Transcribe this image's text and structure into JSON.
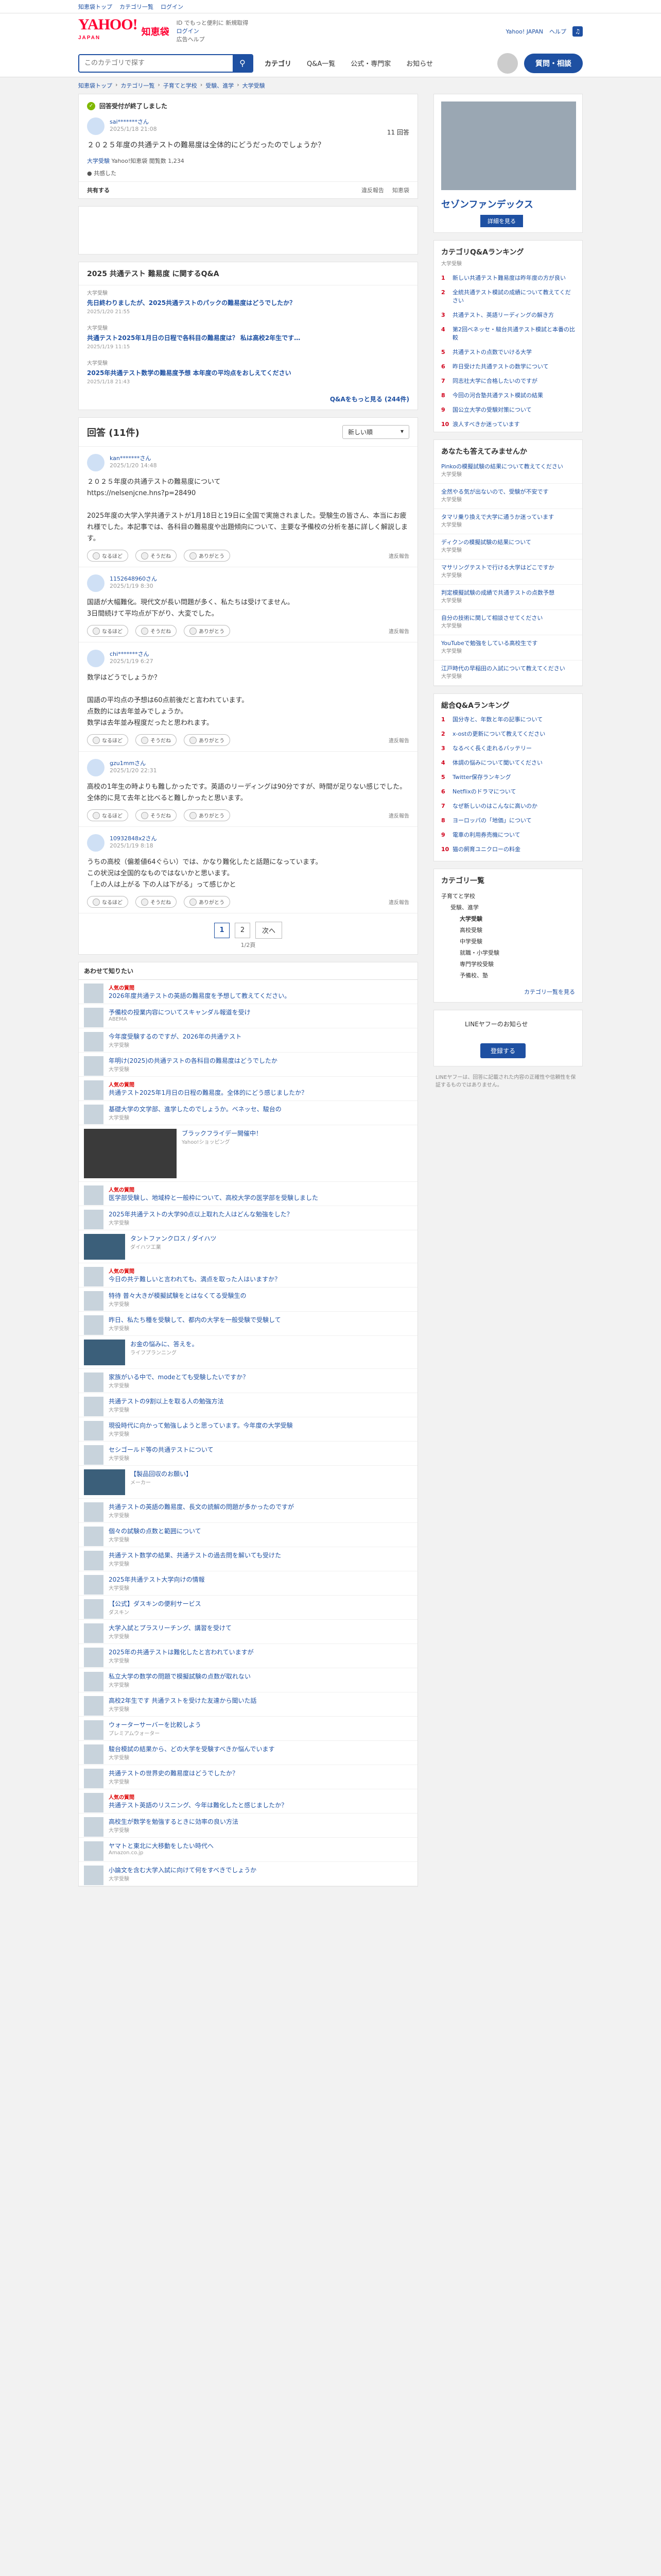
{
  "topbar": {
    "links": [
      "知恵袋トップ",
      "カテゴリ一覧",
      "ログイン"
    ]
  },
  "header": {
    "logo": "YAHOO!",
    "logo_sub": "JAPAN",
    "service": "知恵袋",
    "lines": [
      "ID でもっと便利に 新規取得",
      "ログイン",
      "広告ヘルプ"
    ],
    "right_links": [
      "Yahoo! JAPAN",
      "ヘルプ"
    ]
  },
  "nav": {
    "search_placeholder": "このカテゴリで探す",
    "items": [
      "カテゴリ",
      "Q&A一覧",
      "公式・専門家",
      "お知らせ"
    ],
    "ask_label": "質問・相談"
  },
  "breadcrumb": [
    "知恵袋トップ",
    "カテゴリ一覧",
    "子育てと学校",
    "受験、進学",
    "大学受験"
  ],
  "question": {
    "solved_label": "回答受付が終了しました",
    "user": "sai*******さん",
    "date": "2025/1/18 21:08",
    "text": "２０２５年度の共通テストの難易度は全体的にどうだったのでしょうか？",
    "tag_label": "大学受験",
    "tag2": "Yahoo!知恵袋",
    "views": "閲覧数 1,234",
    "answers": "11 回答",
    "thanks": "共感した",
    "share": "共有する",
    "foot": [
      "違反報告",
      "知恵袋"
    ]
  },
  "related": {
    "title": "2025 共通テスト 難易度 に関するQ&A",
    "items": [
      {
        "cat": "大学受験",
        "title": "先日終わりましたが、2025共通テストのパックの難易度はどうでしたか？",
        "meta": "2025/1/20 21:55"
      },
      {
        "cat": "大学受験",
        "title": "共通テスト2025年1月日の日程で各科目の難易度は？ 私は高校2年生です…",
        "meta": "2025/1/19 11:15"
      },
      {
        "cat": "大学受験",
        "title": "2025年共通テスト数学の難易度予想 本年度の平均点をおしえてください",
        "meta": "2025/1/18 21:43"
      }
    ],
    "more": "Q&Aをもっと見る (244件)"
  },
  "answers": {
    "title": "回答 (11件)",
    "sort": "新しい順",
    "react_labels": [
      "なるほど",
      "そうだね",
      "ありがとう"
    ],
    "report": "違反報告",
    "items": [
      {
        "user": "kan*******さん",
        "date": "2025/1/20 14:48",
        "text": "２０２５年度の共通テストの難易度について\nhttps://nelsenjcne.hns?p=28490\n\n2025年度の大学入学共通テストが1月18日と19日に全国で実施されました。受験生の皆さん、本当にお疲れ様でした。本記事では、各科目の難易度や出題傾向について、主要な予備校の分析を基に詳しく解説します。"
      },
      {
        "user": "1152648960さん",
        "date": "2025/1/19 8:30",
        "text": "国語が大幅難化。現代文が長い問題が多く、私たちは受けてません。\n3日間続けて平均点が下がり、大変でした。"
      },
      {
        "user": "chi*******さん",
        "date": "2025/1/19 6:27",
        "text": "数学はどうでしょうか？\n\n国語の平均点の予想は60点前後だと言われています。\n点数的には去年並みでしょうか。\n数学は去年並み程度だったと思われます。"
      },
      {
        "user": "gzu1mmさん",
        "date": "2025/1/20 22:31",
        "text": "高校の1年生の時よりも難しかったです。英語のリーディングは90分ですが、時間が足りない感じでした。\n全体的に見て去年と比べると難しかったと思います。"
      },
      {
        "user": "10932848x2さん",
        "date": "2025/1/19 8:18",
        "text": "うちの高校（偏差値64ぐらい）では、かなり難化したと話題になっています。\nこの状況は全国的なものではないかと思います。\n「上の人は上がる 下の人は下がる」って感じかと"
      }
    ],
    "pages": [
      "1",
      "2"
    ],
    "next": "次へ",
    "count": "1/2頁"
  },
  "feed": {
    "title": "あわせて知りたい",
    "items": [
      {
        "hot": "人気の質問",
        "title": "2026年度共通テストの英語の難易度を予想して教えてください。",
        "cat": "大学受験"
      },
      {
        "hot": "",
        "title": "予備校の授業内容についてスキャンダル報道を受け",
        "cat": "ABEMA"
      },
      {
        "hot": "",
        "title": "今年度受験するのですが、2026年の共通テスト",
        "cat": "大学受験"
      },
      {
        "hot": "",
        "title": "年明け(2025)の共通テストの各科目の難易度はどうでしたか",
        "cat": "大学受験"
      },
      {
        "hot": "人気の質問",
        "title": "共通テスト2025年1月日の日程の難易度。全体的にどう感じましたか？",
        "cat": "大学受験"
      },
      {
        "hot": "",
        "title": "基礎大学の文学部、進学したのでしょうか。ベネッセ、駿台の",
        "cat": "大学受験"
      },
      {
        "hot": "",
        "title": "ブラックフライデー開催中！",
        "cat": "Yahoo!ショッピング"
      },
      {
        "hot": "人気の質問",
        "title": "医学部受験し、地域枠と一般枠について、高校大学の医学部を受験しました",
        "cat": "大学受験"
      },
      {
        "hot": "",
        "title": "2025年共通テストの大学90点以上取れた人はどんな勉強をした？",
        "cat": "大学受験"
      },
      {
        "hot": "",
        "title": "タントファンクロス / ダイハツ",
        "cat": "ダイハツ工業"
      },
      {
        "hot": "人気の質問",
        "title": "今日の共テ難しいと言われても、満点を取った人はいますか？",
        "cat": "大学受験"
      },
      {
        "hot": "",
        "title": "特待 普々大きが模擬試験をとはなくてる受験生の",
        "cat": "大学受験"
      },
      {
        "hot": "",
        "title": "昨日、私たち種を受験して、都内の大学を一般受験で受験して",
        "cat": "大学受験"
      },
      {
        "hot": "",
        "title": "お金の悩みに、答えを。",
        "cat": "ライフプランニング"
      },
      {
        "hot": "",
        "title": "家族がいる中で、modeとても受験したいですか？",
        "cat": "大学受験"
      },
      {
        "hot": "",
        "title": "共通テストの9割以上を取る人の勉強方法",
        "cat": "大学受験"
      },
      {
        "hot": "",
        "title": "現役時代に向かって勉強しようと思っています。今年度の大学受験",
        "cat": "大学受験"
      },
      {
        "hot": "",
        "title": "セシゴールド等の共通テストについて",
        "cat": "大学受験"
      },
      {
        "hot": "",
        "title": "【製品回収のお願い】",
        "cat": "メーカー"
      },
      {
        "hot": "",
        "title": "共通テストの英語の難易度、長文の読解の問題が多かったのですが",
        "cat": "大学受験"
      },
      {
        "hot": "",
        "title": "個々の試験の点数と範囲について",
        "cat": "大学受験"
      },
      {
        "hot": "",
        "title": "共通テスト数学の結果、共通テストの過去問を解いても受けた",
        "cat": "大学受験"
      },
      {
        "hot": "",
        "title": "2025年共通テスト大学向けの情報",
        "cat": "大学受験"
      },
      {
        "hot": "",
        "title": "【公式】ダスキンの便利サービス",
        "cat": "ダスキン"
      },
      {
        "hot": "",
        "title": "大学入試とプラスリーチング、講習を受けて",
        "cat": "大学受験"
      },
      {
        "hot": "",
        "title": "2025年の共通テストは難化したと言われていますが",
        "cat": "大学受験"
      },
      {
        "hot": "",
        "title": "私立大学の数学の問題で模擬試験の点数が取れない",
        "cat": "大学受験"
      },
      {
        "hot": "",
        "title": "高校2年生です 共通テストを受けた友達から聞いた話",
        "cat": "大学受験"
      },
      {
        "hot": "",
        "title": "ウォーターサーバーを比較しよう",
        "cat": "プレミアムウォーター"
      },
      {
        "hot": "",
        "title": "駿台模試の結果から、どの大学を受験すべきか悩んでいます",
        "cat": "大学受験"
      },
      {
        "hot": "",
        "title": "共通テストの世界史の難易度はどうでしたか？",
        "cat": "大学受験"
      },
      {
        "hot": "人気の質問",
        "title": "共通テスト英語のリスニング、今年は難化したと感じましたか？",
        "cat": "大学受験"
      },
      {
        "hot": "",
        "title": "高校生が数学を勉強するときに効率の良い方法",
        "cat": "大学受験"
      },
      {
        "hot": "",
        "title": "ヤマトと東北に大移動をしたい時代へ",
        "cat": "Amazon.co.jp"
      },
      {
        "hot": "",
        "title": "小論文を含む大学入試に向けて何をすべきでしょうか",
        "cat": "大学受験"
      }
    ]
  },
  "sidebar": {
    "ad_brand": "セゾンファンデックス",
    "ad_cta": "詳細を見る",
    "ranking_title": "カテゴリQ&Aランキング",
    "ranking_sub": "大学受験",
    "ranking": [
      "新しい共通テスト難易度は昨年度の方が良い",
      "全統共通テスト模試の成績について教えてください",
      "共通テスト、英語リーディングの解き方",
      "第2回ベネッセ・駿台共通テスト模試と本番の比較",
      "共通テストの点数でいける大学",
      "昨日受けた共通テストの数学について",
      "同志社大学に合格したいのですが",
      "今回の河合塾共通テスト模試の結果",
      "国公立大学の受験対策について",
      "浪人すべきか迷っています"
    ],
    "picks_title": "あなたも答えてみませんか",
    "picks": [
      {
        "t": "Pinkoの模擬試験の結果について教えてください",
        "c": "大学受験"
      },
      {
        "t": "全然やる気が出ないので、受験が不安です",
        "c": "大学受験"
      },
      {
        "t": "タマリ乗り換えで大学に通うか迷っています",
        "c": "大学受験"
      },
      {
        "t": "ディクンの模擬試験の結果について",
        "c": "大学受験"
      },
      {
        "t": "マサリングテストで行ける大学はどこですか",
        "c": "大学受験"
      },
      {
        "t": "判定模擬試験の成績で共通テストの点数予想",
        "c": "大学受験"
      },
      {
        "t": "自分の技術に関して相談させてください",
        "c": "大学受験"
      },
      {
        "t": "YouTubeで勉強をしている高校生です",
        "c": "大学受験"
      },
      {
        "t": "江戸時代の早稲田の入試について教えてください",
        "c": "大学受験"
      }
    ],
    "overall_title": "総合Q&Aランキング",
    "overall": [
      "国分寺と、年数と年の記事について",
      "x-ostの更新について教えてください",
      "なるべく長く走れるバッテリー",
      "体調の悩みについて聞いてください",
      "Twitter保存ランキング",
      "Netflixのドラマについて",
      "なぜ新しいのはこんなに高いのか",
      "ヨーロッパの「地価」について",
      "電車の利用券売機について",
      "猫の飼育ユニクローの料金"
    ],
    "cat_title": "カテゴリ一覧",
    "cats": [
      {
        "lv": 1,
        "t": "子育てと学校"
      },
      {
        "lv": 2,
        "t": "受験、進学"
      },
      {
        "lv": 3,
        "t": "大学受験",
        "on": true
      },
      {
        "lv": 3,
        "t": "高校受験"
      },
      {
        "lv": 3,
        "t": "中学受験"
      },
      {
        "lv": 3,
        "t": "就職・小学受験"
      },
      {
        "lv": 3,
        "t": "専門学校受験"
      },
      {
        "lv": 3,
        "t": "予備校、塾"
      }
    ],
    "cat_more": "カテゴリ一覧を見る",
    "side_ad_label": "LINEヤフーのお知らせ",
    "side_ad_btn": "登録する",
    "footnote": "LINEヤフーは、回答に記載された内容の正確性や信頼性を保証するものではありません。"
  },
  "colors": {
    "brand": "#ff0033",
    "link": "#1e50a2",
    "accent_green": "#7fb800"
  }
}
